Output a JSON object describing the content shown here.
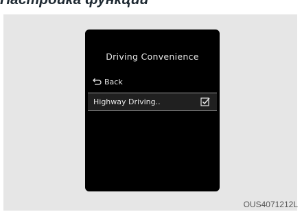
{
  "header": {
    "title": "Настройка функций"
  },
  "screen": {
    "title": "Driving Convenience",
    "menu": {
      "back_label": "Back",
      "back_icon": "back-arrow-icon",
      "highway_label": "Highway Driving..",
      "highway_checked": true,
      "highway_icon": "checkbox-checked-icon"
    }
  },
  "caption": "OUS4071212L"
}
